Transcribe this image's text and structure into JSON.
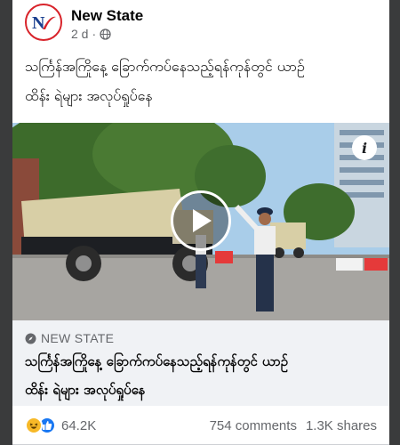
{
  "post": {
    "page_name": "New State",
    "time": "2 d",
    "privacy_icon": "globe-icon",
    "text_line1": "သင်္ကြန်အကြိုနေ့ ခြောက်ကပ်နေသည့်ရန်ကုန်တွင် ယာဉ်",
    "text_line2": "ထိန်း ရဲများ အလုပ်ရှုပ်နေ"
  },
  "media": {
    "type": "video",
    "play_icon": "play-icon",
    "info_icon": "info-icon",
    "info_label": "i"
  },
  "link_preview": {
    "domain": "NEW STATE",
    "domain_icon": "compass-icon",
    "title_line1": "သင်္ကြန်အကြိုနေ့ ခြောက်ကပ်နေသည့်ရန်ကုန်တွင် ယာဉ်",
    "title_line2": "ထိန်း ရဲများ အလုပ်ရှုပ်နေ"
  },
  "engagement": {
    "reaction_icons": [
      "haha-icon",
      "like-icon"
    ],
    "reaction_count": "64.2K",
    "comments": "754 comments",
    "shares": "1.3K shares"
  },
  "colors": {
    "brand_red": "#d8232a",
    "like_blue": "#1877f2",
    "haha_yellow": "#f7b928",
    "secondary_text": "#65676b"
  }
}
